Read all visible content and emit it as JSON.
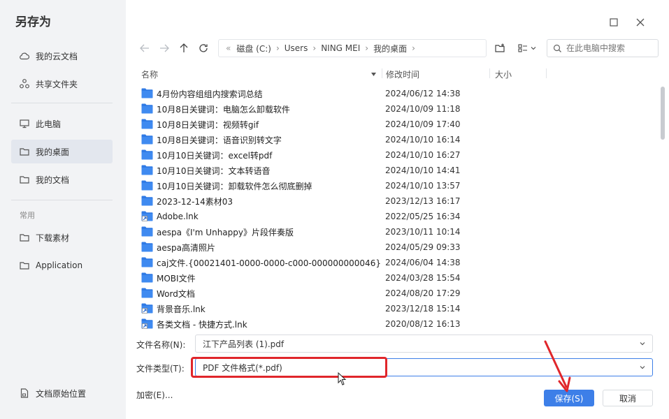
{
  "dialog": {
    "title": "另存为"
  },
  "sidebar": {
    "items": [
      {
        "label": "我的云文档",
        "icon": "cloud-icon"
      },
      {
        "label": "共享文件夹",
        "icon": "share-icon"
      },
      {
        "label": "此电脑",
        "icon": "computer-icon"
      },
      {
        "label": "我的桌面",
        "icon": "folder-icon",
        "active": true
      },
      {
        "label": "我的文档",
        "icon": "folder-icon"
      }
    ],
    "section_label": "常用",
    "common_items": [
      {
        "label": "下载素材",
        "icon": "folder-icon"
      },
      {
        "label": "Application",
        "icon": "folder-icon"
      }
    ],
    "bottom_item": {
      "label": "文档原始位置",
      "icon": "document-icon"
    }
  },
  "breadcrumb": [
    "磁盘 (C:)",
    "Users",
    "NING MEI",
    "我的桌面"
  ],
  "search": {
    "placeholder": "在此电脑中搜索"
  },
  "columns": {
    "name": "名称",
    "modified": "修改时间",
    "size": "大小"
  },
  "files": [
    {
      "name": "4月份内容组组内搜索词总结",
      "date": "2024/06/12 14:38",
      "type": "folder"
    },
    {
      "name": "10月8日关键词：电脑怎么卸载软件",
      "date": "2024/10/09 11:18",
      "type": "folder"
    },
    {
      "name": "10月8日关键词：视频转gif",
      "date": "2024/10/09 17:40",
      "type": "folder"
    },
    {
      "name": "10月8日关键词：语音识别转文字",
      "date": "2024/10/10 16:14",
      "type": "folder"
    },
    {
      "name": "10月10日关键词：excel转pdf",
      "date": "2024/10/10 16:27",
      "type": "folder"
    },
    {
      "name": "10月10日关键词：文本转语音",
      "date": "2024/10/10 14:41",
      "type": "folder"
    },
    {
      "name": "10月10日关键词：卸载软件怎么彻底删掉",
      "date": "2024/10/10 13:57",
      "type": "folder"
    },
    {
      "name": "2023-12-14素材03",
      "date": "2023/12/13 16:17",
      "type": "folder"
    },
    {
      "name": "Adobe.lnk",
      "date": "2022/05/25 16:34",
      "type": "shortcut"
    },
    {
      "name": "aespa《I'm Unhappy》片段伴奏版",
      "date": "2023/10/11 10:14",
      "type": "folder"
    },
    {
      "name": "aespa高清照片",
      "date": "2024/05/29 09:33",
      "type": "folder"
    },
    {
      "name": "caj文件.{00021401-0000-0000-c000-000000000046}",
      "date": "2024/06/04 14:38",
      "type": "folder"
    },
    {
      "name": "MOBI文件",
      "date": "2024/03/28 15:54",
      "type": "folder"
    },
    {
      "name": "Word文档",
      "date": "2024/08/20 17:29",
      "type": "folder"
    },
    {
      "name": "背景音乐.lnk",
      "date": "2023/12/18 15:14",
      "type": "shortcut"
    },
    {
      "name": "各类文档 - 快捷方式.lnk",
      "date": "2020/08/12 16:13",
      "type": "shortcut"
    }
  ],
  "form": {
    "filename_label": "文件名称(N):",
    "filename_value": "江下产品列表 (1).pdf",
    "filetype_label": "文件类型(T):",
    "filetype_value": "PDF 文件格式(*.pdf)"
  },
  "footer": {
    "encrypt_label": "加密(E)...",
    "save_label": "保存(S)",
    "cancel_label": "取消"
  },
  "colors": {
    "accent": "#3d7fe8",
    "folder": "#2f7ae5",
    "annotation": "#e0262b",
    "sidebar_bg": "#f2f3f5"
  }
}
